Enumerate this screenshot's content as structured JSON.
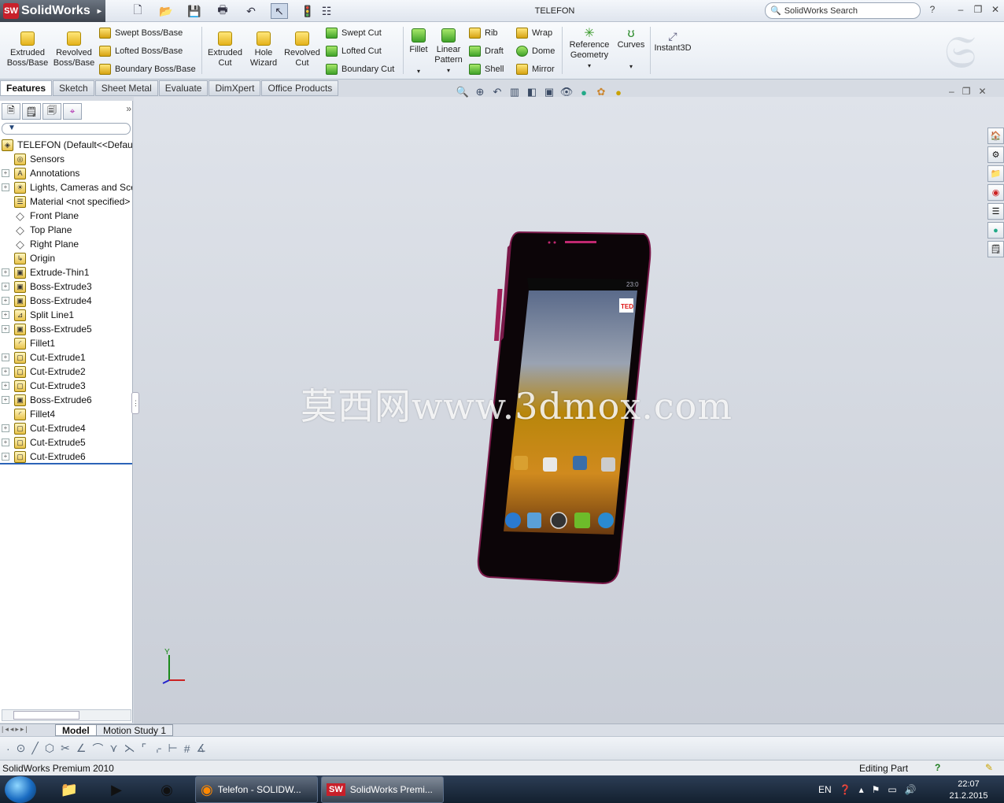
{
  "app": {
    "name": "SolidWorks",
    "window_title": "TELEFON",
    "search_placeholder": "SolidWorks Search"
  },
  "ribbon": {
    "tools": [
      {
        "label": "Extruded\nBoss/Base"
      },
      {
        "label": "Revolved\nBoss/Base"
      },
      {
        "label": "Swept Boss/Base"
      },
      {
        "label": "Lofted Boss/Base"
      },
      {
        "label": "Boundary Boss/Base"
      },
      {
        "label": "Extruded\nCut"
      },
      {
        "label": "Hole\nWizard"
      },
      {
        "label": "Revolved\nCut"
      },
      {
        "label": "Swept Cut"
      },
      {
        "label": "Lofted Cut"
      },
      {
        "label": "Boundary Cut"
      },
      {
        "label": "Fillet"
      },
      {
        "label": "Linear\nPattern"
      },
      {
        "label": "Rib"
      },
      {
        "label": "Draft"
      },
      {
        "label": "Shell"
      },
      {
        "label": "Wrap"
      },
      {
        "label": "Dome"
      },
      {
        "label": "Mirror"
      },
      {
        "label": "Reference\nGeometry"
      },
      {
        "label": "Curves"
      },
      {
        "label": "Instant3D"
      }
    ]
  },
  "command_tabs": [
    "Features",
    "Sketch",
    "Sheet Metal",
    "Evaluate",
    "DimXpert",
    "Office Products"
  ],
  "tree": {
    "root": "TELEFON  (Default<<Default>",
    "items": [
      {
        "label": "Sensors",
        "expandable": false,
        "icon": "sensor-icon"
      },
      {
        "label": "Annotations",
        "expandable": true,
        "icon": "annotations-icon"
      },
      {
        "label": "Lights, Cameras and Scene",
        "expandable": true,
        "icon": "lights-icon"
      },
      {
        "label": "Material <not specified>",
        "expandable": false,
        "icon": "material-icon"
      },
      {
        "label": "Front Plane",
        "expandable": false,
        "icon": "plane-icon"
      },
      {
        "label": "Top Plane",
        "expandable": false,
        "icon": "plane-icon"
      },
      {
        "label": "Right Plane",
        "expandable": false,
        "icon": "plane-icon"
      },
      {
        "label": "Origin",
        "expandable": false,
        "icon": "origin-icon"
      },
      {
        "label": "Extrude-Thin1",
        "expandable": true,
        "icon": "extrude-icon"
      },
      {
        "label": "Boss-Extrude3",
        "expandable": true,
        "icon": "extrude-icon"
      },
      {
        "label": "Boss-Extrude4",
        "expandable": true,
        "icon": "extrude-icon"
      },
      {
        "label": "Split Line1",
        "expandable": true,
        "icon": "split-line-icon"
      },
      {
        "label": "Boss-Extrude5",
        "expandable": true,
        "icon": "extrude-icon"
      },
      {
        "label": "Fillet1",
        "expandable": false,
        "icon": "fillet-icon"
      },
      {
        "label": "Cut-Extrude1",
        "expandable": true,
        "icon": "cut-icon"
      },
      {
        "label": "Cut-Extrude2",
        "expandable": true,
        "icon": "cut-icon"
      },
      {
        "label": "Cut-Extrude3",
        "expandable": true,
        "icon": "cut-icon"
      },
      {
        "label": "Boss-Extrude6",
        "expandable": true,
        "icon": "extrude-icon"
      },
      {
        "label": "Fillet4",
        "expandable": false,
        "icon": "fillet-icon"
      },
      {
        "label": "Cut-Extrude4",
        "expandable": true,
        "icon": "cut-icon"
      },
      {
        "label": "Cut-Extrude5",
        "expandable": true,
        "icon": "cut-icon"
      },
      {
        "label": "Cut-Extrude6",
        "expandable": true,
        "icon": "cut-icon"
      }
    ]
  },
  "viewport": {
    "watermark": "莫西网www.3dmox.com",
    "phone_status_time": "23:0",
    "phone_badge": "TED",
    "axis_label": "Y"
  },
  "bottom_tabs": [
    "Model",
    "Motion Study 1"
  ],
  "status": {
    "left": "SolidWorks Premium 2010",
    "right": "Editing Part"
  },
  "taskbar": {
    "buttons": [
      "Telefon - SOLIDW...",
      "SolidWorks Premi..."
    ],
    "lang": "EN",
    "time": "22:07",
    "date": "21.2.2015"
  }
}
